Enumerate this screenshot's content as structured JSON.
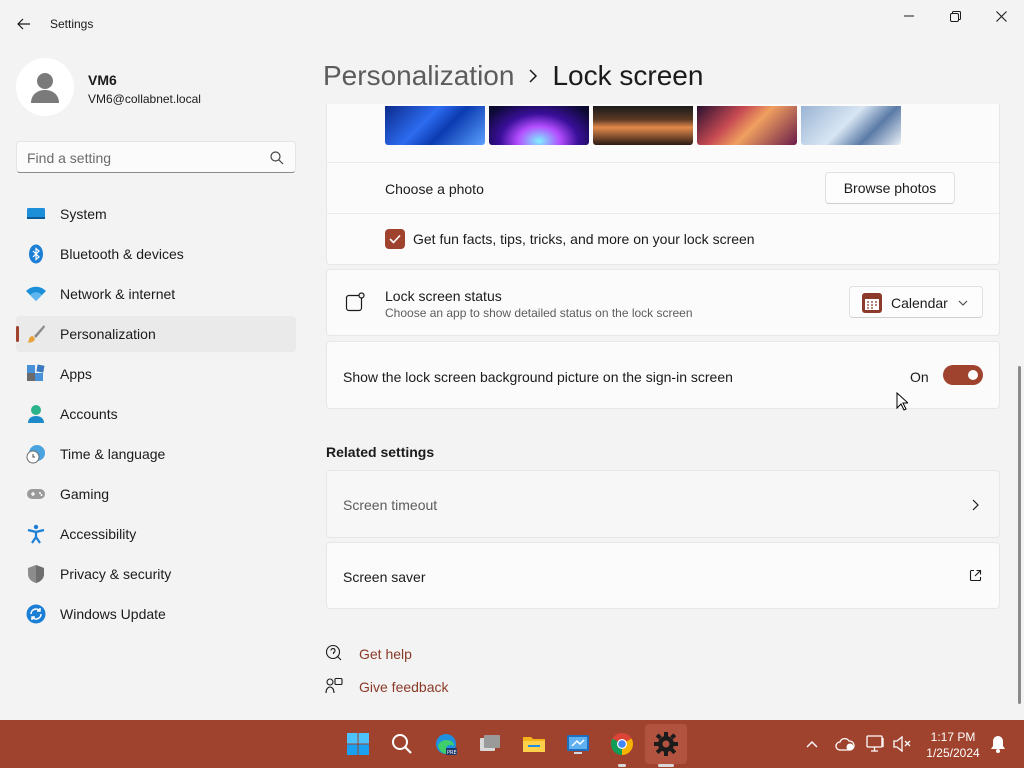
{
  "window": {
    "title": "Settings"
  },
  "user": {
    "name": "VM6",
    "email": "VM6@collabnet.local"
  },
  "search": {
    "placeholder": "Find a setting"
  },
  "nav": [
    {
      "label": "System",
      "icon": "system-icon"
    },
    {
      "label": "Bluetooth & devices",
      "icon": "bluetooth-icon"
    },
    {
      "label": "Network & internet",
      "icon": "wifi-icon"
    },
    {
      "label": "Personalization",
      "icon": "brush-icon",
      "selected": true
    },
    {
      "label": "Apps",
      "icon": "apps-icon"
    },
    {
      "label": "Accounts",
      "icon": "accounts-icon"
    },
    {
      "label": "Time & language",
      "icon": "clock-globe-icon"
    },
    {
      "label": "Gaming",
      "icon": "gamepad-icon"
    },
    {
      "label": "Accessibility",
      "icon": "accessibility-icon"
    },
    {
      "label": "Privacy & security",
      "icon": "shield-icon"
    },
    {
      "label": "Windows Update",
      "icon": "update-icon"
    }
  ],
  "breadcrumb": {
    "parent": "Personalization",
    "current": "Lock screen"
  },
  "lock_screen": {
    "choose_photo_label": "Choose a photo",
    "browse_photos_button": "Browse photos",
    "fun_facts_label": "Get fun facts, tips, tricks, and more on your lock screen",
    "fun_facts_checked": true,
    "status_title": "Lock screen status",
    "status_subtitle": "Choose an app to show detailed status on the lock screen",
    "status_app": "Calendar",
    "signin_bg_label": "Show the lock screen background picture on the sign-in screen",
    "signin_bg_state": "On"
  },
  "related": {
    "title": "Related settings",
    "screen_timeout": "Screen timeout",
    "screen_saver": "Screen saver"
  },
  "help": {
    "get_help": "Get help",
    "give_feedback": "Give feedback"
  },
  "taskbar": {
    "time": "1:17 PM",
    "date": "1/25/2024"
  },
  "colors": {
    "accent": "#a0432e",
    "background": "#f3f3f3",
    "card": "#fbfbfb"
  }
}
